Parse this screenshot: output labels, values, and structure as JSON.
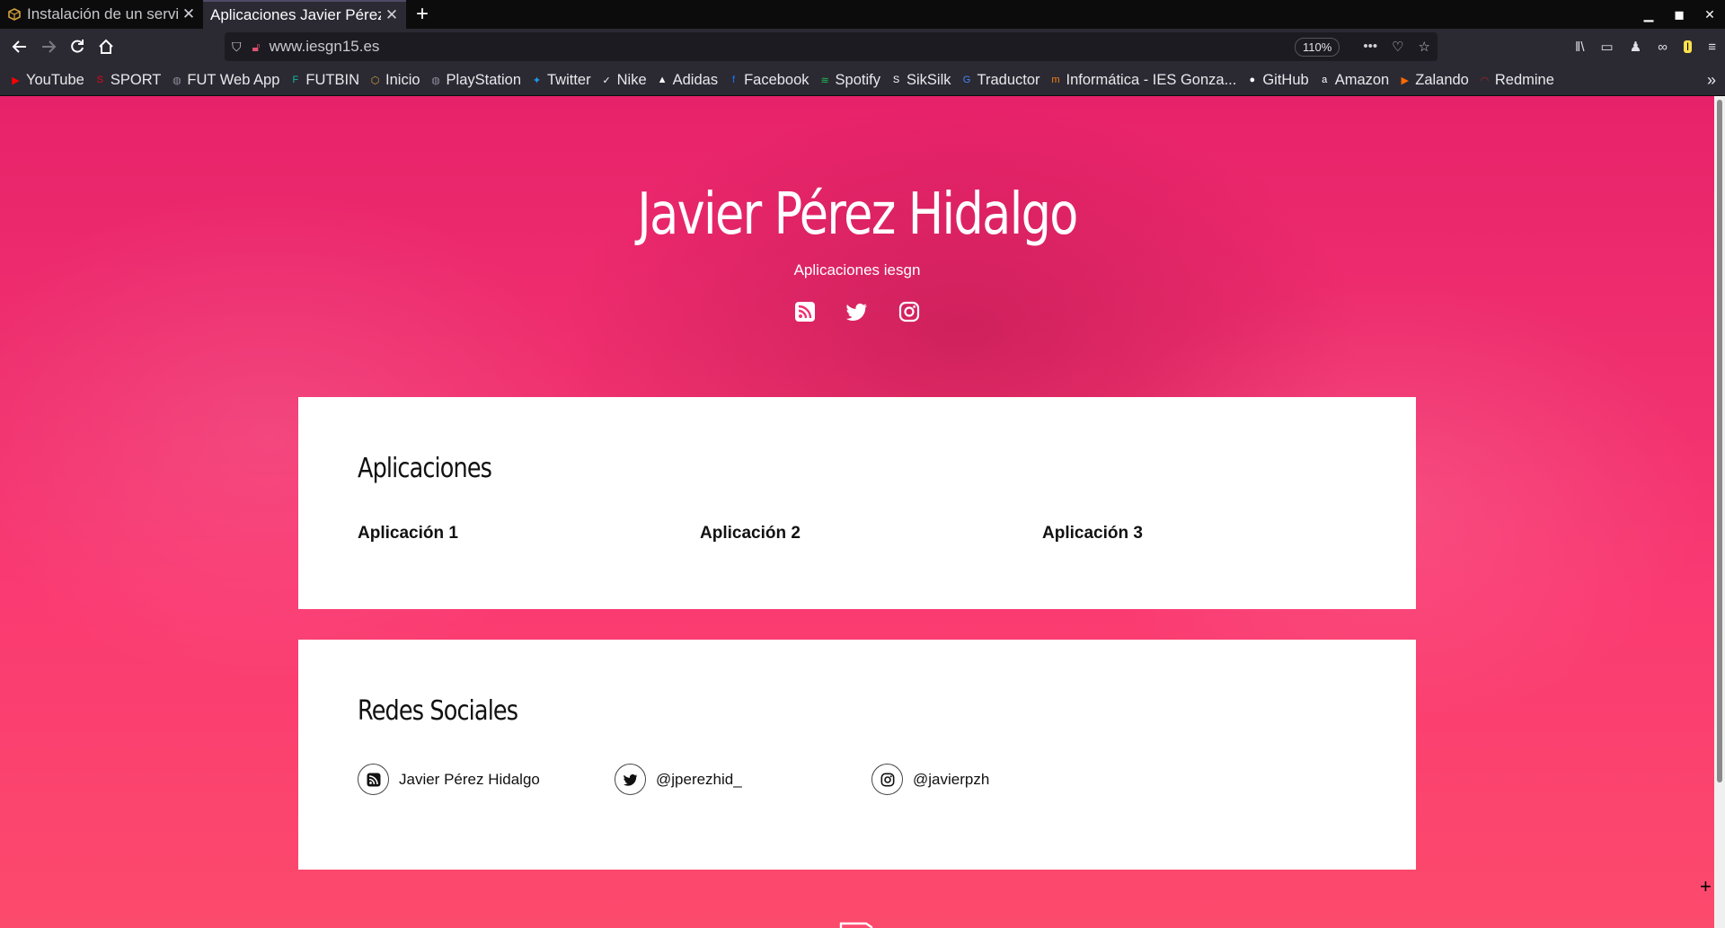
{
  "tabs": [
    {
      "title": "Instalación de un servidor",
      "favicon": "cube-icon",
      "active": false
    },
    {
      "title": "Aplicaciones Javier Pérez Hidalgo",
      "favicon": "",
      "active": true
    }
  ],
  "navbar": {
    "url": "www.iesgn15.es",
    "zoom": "110%"
  },
  "bookmarks": [
    {
      "label": "YouTube",
      "icon": "youtube-icon",
      "color": "#ff0000"
    },
    {
      "label": "SPORT",
      "icon": "sport-icon",
      "color": "#e30613"
    },
    {
      "label": "FUT Web App",
      "icon": "globe-icon",
      "color": "#8f8f9d"
    },
    {
      "label": "FUTBIN",
      "icon": "futbin-icon",
      "color": "#0fb8a0"
    },
    {
      "label": "Inicio",
      "icon": "cube-icon",
      "color": "#d4a13a"
    },
    {
      "label": "PlayStation",
      "icon": "globe-icon",
      "color": "#8f8f9d"
    },
    {
      "label": "Twitter",
      "icon": "twitter-icon",
      "color": "#1d9bf0"
    },
    {
      "label": "Nike",
      "icon": "nike-icon",
      "color": "#ffffff"
    },
    {
      "label": "Adidas",
      "icon": "adidas-icon",
      "color": "#ffffff"
    },
    {
      "label": "Facebook",
      "icon": "facebook-icon",
      "color": "#1877f2"
    },
    {
      "label": "Spotify",
      "icon": "spotify-icon",
      "color": "#1db954"
    },
    {
      "label": "SikSilk",
      "icon": "siksilk-icon",
      "color": "#ffffff"
    },
    {
      "label": "Traductor",
      "icon": "translate-icon",
      "color": "#4285f4"
    },
    {
      "label": "Informática - IES Gonza...",
      "icon": "moodle-icon",
      "color": "#f98012"
    },
    {
      "label": "GitHub",
      "icon": "github-icon",
      "color": "#ffffff"
    },
    {
      "label": "Amazon",
      "icon": "amazon-icon",
      "color": "#ffffff"
    },
    {
      "label": "Zalando",
      "icon": "zalando-icon",
      "color": "#ff6900"
    },
    {
      "label": "Redmine",
      "icon": "redmine-icon",
      "color": "#b32024"
    }
  ],
  "hero": {
    "title": "Javier Pérez Hidalgo",
    "subtitle": "Aplicaciones iesgn"
  },
  "apps_section": {
    "heading": "Aplicaciones",
    "items": [
      "Aplicación 1",
      "Aplicación 2",
      "Aplicación 3"
    ]
  },
  "social_section": {
    "heading": "Redes Sociales",
    "items": [
      {
        "label": "Javier Pérez Hidalgo",
        "icon": "rss-icon"
      },
      {
        "label": "@jperezhid_",
        "icon": "twitter-icon"
      },
      {
        "label": "@javierpzh",
        "icon": "instagram-icon"
      }
    ]
  },
  "colors": {
    "accent": "#f0306f",
    "card": "#ffffff"
  }
}
